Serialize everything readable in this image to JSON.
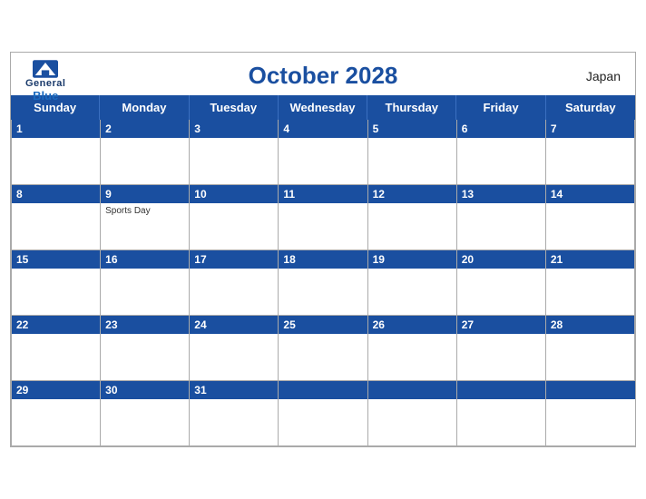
{
  "header": {
    "title": "October 2028",
    "country": "Japan",
    "logo": {
      "general": "General",
      "blue": "Blue"
    }
  },
  "days": [
    "Sunday",
    "Monday",
    "Tuesday",
    "Wednesday",
    "Thursday",
    "Friday",
    "Saturday"
  ],
  "weeks": [
    [
      {
        "date": "1",
        "holiday": ""
      },
      {
        "date": "2",
        "holiday": ""
      },
      {
        "date": "3",
        "holiday": ""
      },
      {
        "date": "4",
        "holiday": ""
      },
      {
        "date": "5",
        "holiday": ""
      },
      {
        "date": "6",
        "holiday": ""
      },
      {
        "date": "7",
        "holiday": ""
      }
    ],
    [
      {
        "date": "8",
        "holiday": ""
      },
      {
        "date": "9",
        "holiday": "Sports Day"
      },
      {
        "date": "10",
        "holiday": ""
      },
      {
        "date": "11",
        "holiday": ""
      },
      {
        "date": "12",
        "holiday": ""
      },
      {
        "date": "13",
        "holiday": ""
      },
      {
        "date": "14",
        "holiday": ""
      }
    ],
    [
      {
        "date": "15",
        "holiday": ""
      },
      {
        "date": "16",
        "holiday": ""
      },
      {
        "date": "17",
        "holiday": ""
      },
      {
        "date": "18",
        "holiday": ""
      },
      {
        "date": "19",
        "holiday": ""
      },
      {
        "date": "20",
        "holiday": ""
      },
      {
        "date": "21",
        "holiday": ""
      }
    ],
    [
      {
        "date": "22",
        "holiday": ""
      },
      {
        "date": "23",
        "holiday": ""
      },
      {
        "date": "24",
        "holiday": ""
      },
      {
        "date": "25",
        "holiday": ""
      },
      {
        "date": "26",
        "holiday": ""
      },
      {
        "date": "27",
        "holiday": ""
      },
      {
        "date": "28",
        "holiday": ""
      }
    ],
    [
      {
        "date": "29",
        "holiday": ""
      },
      {
        "date": "30",
        "holiday": ""
      },
      {
        "date": "31",
        "holiday": ""
      },
      {
        "date": "",
        "holiday": ""
      },
      {
        "date": "",
        "holiday": ""
      },
      {
        "date": "",
        "holiday": ""
      },
      {
        "date": "",
        "holiday": ""
      }
    ]
  ]
}
